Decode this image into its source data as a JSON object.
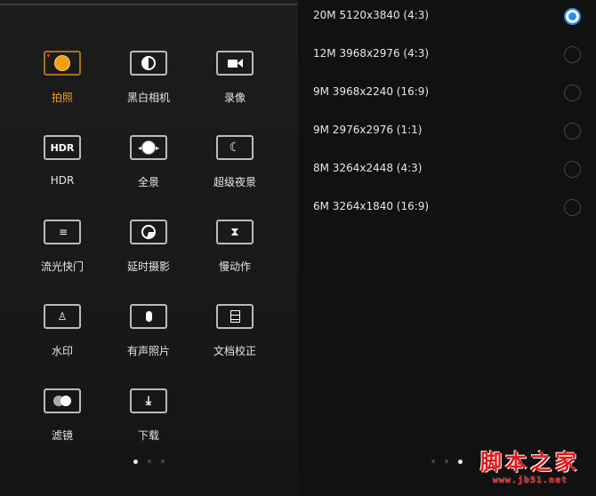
{
  "modes": [
    {
      "label": "拍照",
      "icon": "photo-shutter-icon",
      "active": true
    },
    {
      "label": "黑白相机",
      "icon": "monochrome-icon"
    },
    {
      "label": "录像",
      "icon": "video-camera-icon"
    },
    {
      "label": "HDR",
      "icon": "hdr-icon",
      "icon_text": "HDR"
    },
    {
      "label": "全景",
      "icon": "panorama-icon"
    },
    {
      "label": "超级夜景",
      "icon": "night-moon-icon"
    },
    {
      "label": "流光快门",
      "icon": "light-trails-icon"
    },
    {
      "label": "延时摄影",
      "icon": "timelapse-icon"
    },
    {
      "label": "慢动作",
      "icon": "hourglass-icon"
    },
    {
      "label": "水印",
      "icon": "watermark-stamp-icon"
    },
    {
      "label": "有声照片",
      "icon": "microphone-icon"
    },
    {
      "label": "文档校正",
      "icon": "document-icon"
    },
    {
      "label": "滤镜",
      "icon": "filter-icon"
    },
    {
      "label": "下载",
      "icon": "download-icon"
    }
  ],
  "left_pager": {
    "pages": 3,
    "current": 1
  },
  "resolutions": [
    {
      "label": "20M 5120x3840 (4:3)",
      "selected": true
    },
    {
      "label": "12M 3968x2976 (4:3)",
      "selected": false
    },
    {
      "label": "9M 3968x2240 (16:9)",
      "selected": false
    },
    {
      "label": "9M 2976x2976 (1:1)",
      "selected": false
    },
    {
      "label": "8M 3264x2448 (4:3)",
      "selected": false
    },
    {
      "label": "6M 3264x1840 (16:9)",
      "selected": false
    }
  ],
  "right_pager": {
    "pages": 3,
    "current": 3
  },
  "watermark": {
    "title": "脚本之家",
    "url": "www.jb51.net"
  },
  "colors": {
    "accent": "#f0a020",
    "radio": "#2b8cf0",
    "watermark": "#e01818"
  }
}
